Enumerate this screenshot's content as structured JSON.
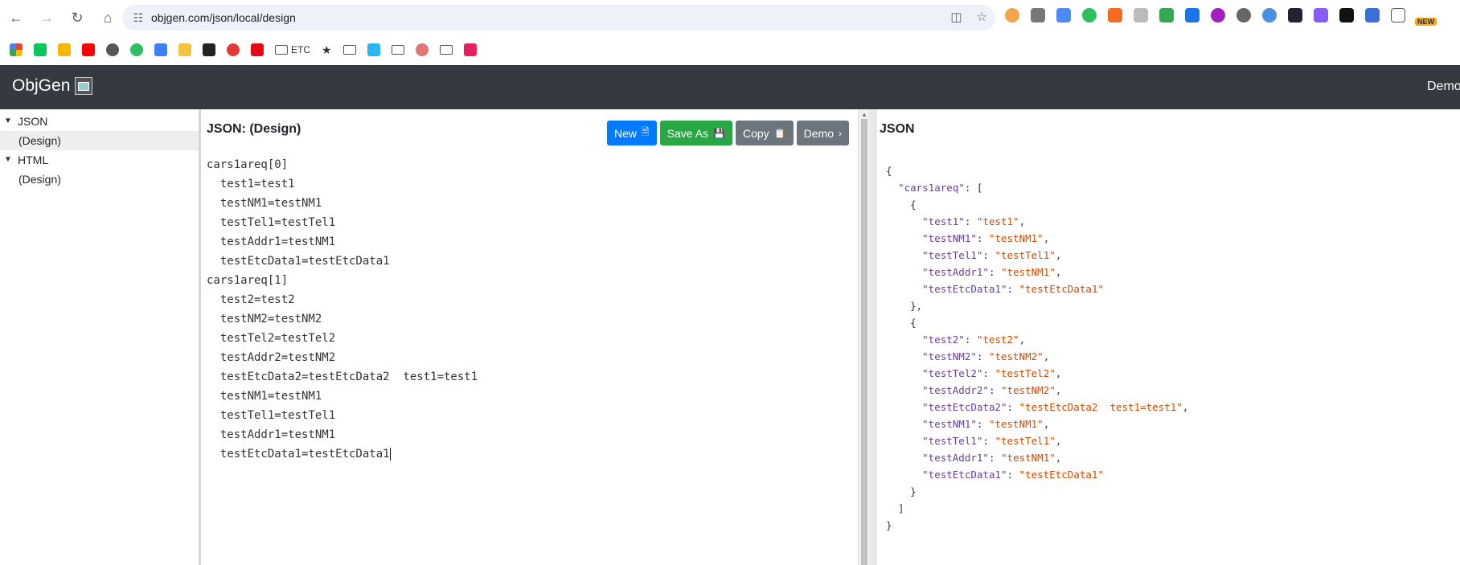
{
  "browser": {
    "url": "objgen.com/json/local/design",
    "new_badge": "NEW",
    "bookmarks": [
      "ETC"
    ]
  },
  "app": {
    "brand": "ObjGen",
    "nav_right": "Demo"
  },
  "sidebar": {
    "items": [
      {
        "label": "JSON",
        "level": 0
      },
      {
        "label": "(Design)",
        "level": 1,
        "selected": true
      },
      {
        "label": "HTML",
        "level": 0
      },
      {
        "label": "(Design)",
        "level": 1
      }
    ]
  },
  "editor": {
    "title": "JSON: (Design)",
    "buttons": {
      "new": "New",
      "save_as": "Save As",
      "copy": "Copy",
      "demo": "Demo"
    },
    "lines": [
      "cars1areq[0]",
      "  test1=test1",
      "  testNM1=testNM1",
      "  testTel1=testTel1",
      "  testAddr1=testNM1",
      "  testEtcData1=testEtcData1",
      "cars1areq[1]",
      "  test2=test2",
      "  testNM2=testNM2",
      "  testTel2=testTel2",
      "  testAddr2=testNM2",
      "  testEtcData2=testEtcData2  test1=test1",
      "  testNM1=testNM1",
      "  testTel1=testTel1",
      "  testAddr1=testNM1",
      "  testEtcData1=testEtcData1"
    ]
  },
  "output": {
    "title": "JSON",
    "root_key": "cars1areq",
    "objects": [
      [
        [
          "test1",
          "test1"
        ],
        [
          "testNM1",
          "testNM1"
        ],
        [
          "testTel1",
          "testTel1"
        ],
        [
          "testAddr1",
          "testNM1"
        ],
        [
          "testEtcData1",
          "testEtcData1"
        ]
      ],
      [
        [
          "test2",
          "test2"
        ],
        [
          "testNM2",
          "testNM2"
        ],
        [
          "testTel2",
          "testTel2"
        ],
        [
          "testAddr2",
          "testNM2"
        ],
        [
          "testEtcData2",
          "testEtcData2  test1=test1"
        ],
        [
          "testNM1",
          "testNM1"
        ],
        [
          "testTel1",
          "testTel1"
        ],
        [
          "testAddr1",
          "testNM1"
        ],
        [
          "testEtcData1",
          "testEtcData1"
        ]
      ]
    ]
  },
  "colors": {
    "navbar": "#343a40",
    "btn_primary": "#007bff",
    "btn_success": "#28a745",
    "btn_secondary": "#6c757d",
    "json_key": "#6a3d9a",
    "json_string": "#d14a00"
  }
}
